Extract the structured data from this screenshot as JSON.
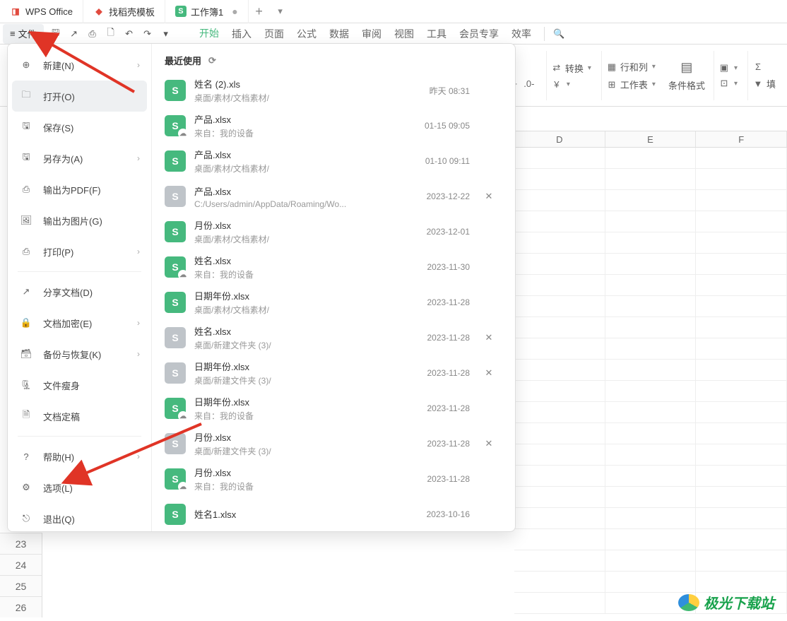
{
  "tabs": {
    "wps": "WPS Office",
    "dk": "找稻壳模板",
    "doc": "工作簿1"
  },
  "ribbon": {
    "file": "文件",
    "tabs": [
      "开始",
      "插入",
      "页面",
      "公式",
      "数据",
      "审阅",
      "视图",
      "工具",
      "会员专享",
      "效率"
    ]
  },
  "toolbar": {
    "convert": "转换",
    "rowcol": "行和列",
    "sheet": "工作表",
    "condfmt": "条件格式",
    "fillshape": "填"
  },
  "file_menu": {
    "items": [
      {
        "label": "新建(N)",
        "arrow": true
      },
      {
        "label": "打开(O)",
        "active": true
      },
      {
        "label": "保存(S)"
      },
      {
        "label": "另存为(A)",
        "arrow": true
      },
      {
        "label": "输出为PDF(F)"
      },
      {
        "label": "输出为图片(G)"
      },
      {
        "label": "打印(P)",
        "arrow": true
      },
      {
        "label": "分享文档(D)"
      },
      {
        "label": "文档加密(E)",
        "arrow": true
      },
      {
        "label": "备份与恢复(K)",
        "arrow": true
      },
      {
        "label": "文件瘦身"
      },
      {
        "label": "文档定稿"
      },
      {
        "label": "帮助(H)",
        "arrow": true
      },
      {
        "label": "选项(L)"
      },
      {
        "label": "退出(Q)"
      }
    ],
    "recent_header": "最近使用",
    "recent": [
      {
        "name": "姓名 (2).xls",
        "path": "桌面/素材/文档素材/",
        "date": "昨天   08:31",
        "green": true
      },
      {
        "name": "产品.xlsx",
        "path": "来自：我的设备",
        "date": "01-15 09:05",
        "green": true,
        "cloud": true
      },
      {
        "name": "产品.xlsx",
        "path": "桌面/素材/文档素材/",
        "date": "01-10 09:11",
        "green": true
      },
      {
        "name": "产品.xlsx",
        "path": "C:/Users/admin/AppData/Roaming/Wo...",
        "date": "2023-12-22",
        "green": false,
        "close": true
      },
      {
        "name": "月份.xlsx",
        "path": "桌面/素材/文档素材/",
        "date": "2023-12-01",
        "green": true
      },
      {
        "name": "姓名.xlsx",
        "path": "来自：我的设备",
        "date": "2023-11-30",
        "green": true,
        "cloud": true
      },
      {
        "name": "日期年份.xlsx",
        "path": "桌面/素材/文档素材/",
        "date": "2023-11-28",
        "green": true
      },
      {
        "name": "姓名.xlsx",
        "path": "桌面/新建文件夹 (3)/",
        "date": "2023-11-28",
        "green": false,
        "close": true
      },
      {
        "name": "日期年份.xlsx",
        "path": "桌面/新建文件夹 (3)/",
        "date": "2023-11-28",
        "green": false,
        "close": true
      },
      {
        "name": "日期年份.xlsx",
        "path": "来自：我的设备",
        "date": "2023-11-28",
        "green": true,
        "cloud": true
      },
      {
        "name": "月份.xlsx",
        "path": "桌面/新建文件夹 (3)/",
        "date": "2023-11-28",
        "green": false,
        "close": true
      },
      {
        "name": "月份.xlsx",
        "path": "来自：我的设备",
        "date": "2023-11-28",
        "green": true,
        "cloud": true
      },
      {
        "name": "姓名1.xlsx",
        "path": "",
        "date": "2023-10-16",
        "green": true
      }
    ]
  },
  "grid": {
    "cols": [
      "D",
      "E",
      "F"
    ],
    "rows": [
      "23",
      "24",
      "25",
      "26"
    ]
  },
  "watermark": "极光下载站"
}
